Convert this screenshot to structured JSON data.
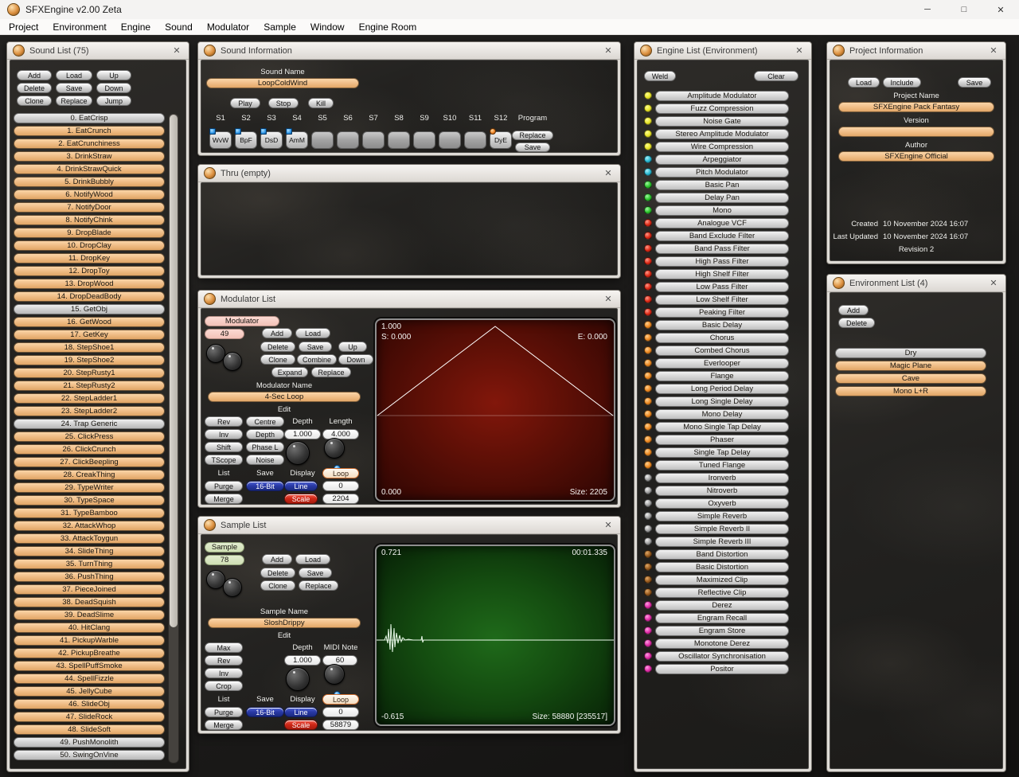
{
  "window": {
    "title": "SFXEngine v2.00 Zeta"
  },
  "icons": {
    "minimize": "─",
    "maximize": "□",
    "close": "✕"
  },
  "menu": {
    "items": [
      "Project",
      "Environment",
      "Engine",
      "Sound",
      "Modulator",
      "Sample",
      "Window",
      "Engine Room"
    ]
  },
  "sound_list": {
    "title": "Sound List (75)",
    "buttons": [
      "Add",
      "Load",
      "Up",
      "Delete",
      "Save",
      "Down",
      "Clone",
      "Replace",
      "Jump"
    ],
    "items": [
      {
        "label": "0. EatCrisp",
        "variant": "gray"
      },
      {
        "label": "1. EatCrunch",
        "variant": "peach"
      },
      {
        "label": "2. EatCrunchiness",
        "variant": "peach"
      },
      {
        "label": "3. DrinkStraw",
        "variant": "peach"
      },
      {
        "label": "4. DrinkStrawQuick",
        "variant": "peach"
      },
      {
        "label": "5. DrinkBubbly",
        "variant": "peach"
      },
      {
        "label": "6. NotifyWood",
        "variant": "peach"
      },
      {
        "label": "7. NotifyDoor",
        "variant": "peach"
      },
      {
        "label": "8. NotifyChink",
        "variant": "peach"
      },
      {
        "label": "9. DropBlade",
        "variant": "peach"
      },
      {
        "label": "10. DropClay",
        "variant": "peach"
      },
      {
        "label": "11. DropKey",
        "variant": "peach"
      },
      {
        "label": "12. DropToy",
        "variant": "peach"
      },
      {
        "label": "13. DropWood",
        "variant": "peach"
      },
      {
        "label": "14. DropDeadBody",
        "variant": "peach"
      },
      {
        "label": "15. GetObj",
        "variant": "gray"
      },
      {
        "label": "16. GetWood",
        "variant": "peach"
      },
      {
        "label": "17. GetKey",
        "variant": "peach"
      },
      {
        "label": "18. StepShoe1",
        "variant": "peach"
      },
      {
        "label": "19. StepShoe2",
        "variant": "peach"
      },
      {
        "label": "20. StepRusty1",
        "variant": "peach"
      },
      {
        "label": "21. StepRusty2",
        "variant": "peach"
      },
      {
        "label": "22. StepLadder1",
        "variant": "peach"
      },
      {
        "label": "23. StepLadder2",
        "variant": "peach"
      },
      {
        "label": "24. Trap Generic",
        "variant": "gray"
      },
      {
        "label": "25. ClickPress",
        "variant": "peach"
      },
      {
        "label": "26. ClickCrunch",
        "variant": "peach"
      },
      {
        "label": "27. ClickBeepling",
        "variant": "peach"
      },
      {
        "label": "28. CreakThing",
        "variant": "peach"
      },
      {
        "label": "29. TypeWriter",
        "variant": "peach"
      },
      {
        "label": "30. TypeSpace",
        "variant": "peach"
      },
      {
        "label": "31. TypeBamboo",
        "variant": "peach"
      },
      {
        "label": "32. AttackWhop",
        "variant": "peach"
      },
      {
        "label": "33. AttackToygun",
        "variant": "peach"
      },
      {
        "label": "34. SlideThing",
        "variant": "peach"
      },
      {
        "label": "35. TurnThing",
        "variant": "peach"
      },
      {
        "label": "36. PushThing",
        "variant": "peach"
      },
      {
        "label": "37. PieceJoined",
        "variant": "peach"
      },
      {
        "label": "38. DeadSquish",
        "variant": "peach"
      },
      {
        "label": "39. DeadSlime",
        "variant": "peach"
      },
      {
        "label": "40. HitClang",
        "variant": "peach"
      },
      {
        "label": "41. PickupWarble",
        "variant": "peach"
      },
      {
        "label": "42. PickupBreathe",
        "variant": "peach"
      },
      {
        "label": "43. SpellPuffSmoke",
        "variant": "peach"
      },
      {
        "label": "44. SpellFizzle",
        "variant": "peach"
      },
      {
        "label": "45. JellyCube",
        "variant": "peach"
      },
      {
        "label": "46. SlideObj",
        "variant": "peach"
      },
      {
        "label": "47. SlideRock",
        "variant": "peach"
      },
      {
        "label": "48. SlideSoft",
        "variant": "peach"
      },
      {
        "label": "49. PushMonolith",
        "variant": "gray"
      },
      {
        "label": "50. SwingOnVine",
        "variant": "gray"
      }
    ]
  },
  "sound_info": {
    "title": "Sound Information",
    "name_label": "Sound Name",
    "name_value": "LoopColdWind",
    "transport": {
      "play": "Play",
      "stop": "Stop",
      "kill": "Kill"
    },
    "program_label": "Program",
    "program": {
      "replace": "Replace",
      "save": "Save"
    },
    "slots": [
      {
        "label": "S1",
        "value": "WvW",
        "led": "blue"
      },
      {
        "label": "S2",
        "value": "BpF",
        "led": "blue"
      },
      {
        "label": "S3",
        "value": "DsD",
        "led": "blue"
      },
      {
        "label": "S4",
        "value": "AmM",
        "led": "blue"
      },
      {
        "label": "S5",
        "value": "",
        "led": ""
      },
      {
        "label": "S6",
        "value": "",
        "led": ""
      },
      {
        "label": "S7",
        "value": "",
        "led": ""
      },
      {
        "label": "S8",
        "value": "",
        "led": ""
      },
      {
        "label": "S9",
        "value": "",
        "led": ""
      },
      {
        "label": "S10",
        "value": "",
        "led": ""
      },
      {
        "label": "S11",
        "value": "",
        "led": ""
      },
      {
        "label": "S12",
        "value": "DyE",
        "led": "orange"
      }
    ]
  },
  "thru": {
    "title": "Thru (empty)"
  },
  "modulator": {
    "title": "Modulator List",
    "index_label": "Modulator",
    "index_value": "49",
    "btn": {
      "add": "Add",
      "load": "Load",
      "delete": "Delete",
      "save": "Save",
      "up": "Up",
      "clone": "Clone",
      "combine": "Combine",
      "down": "Down",
      "expand": "Expand",
      "replace": "Replace"
    },
    "name_label": "Modulator Name",
    "name_value": "4-Sec Loop",
    "edit_label": "Edit",
    "edit_btn": {
      "rev": "Rev",
      "centre": "Centre",
      "inv": "Inv",
      "depth": "Depth",
      "shift": "Shift",
      "phase": "Phase L",
      "tscope": "TScope",
      "noise": "Noise"
    },
    "depth_label": "Depth",
    "length_label": "Length",
    "depth_value": "1.000",
    "length_value": "4.000",
    "bottom": {
      "list": "List",
      "save": "Save",
      "display": "Display",
      "loop": "Loop",
      "purge": "Purge",
      "bit": "16-Bit",
      "line": "Line",
      "zero": "0",
      "merge": "Merge",
      "scale": "Scale",
      "size": "2204"
    },
    "display": {
      "top_left": "1.000",
      "start": "S: 0.000",
      "end": "E: 0.000",
      "bottom_left": "0.000",
      "size": "Size: 2205"
    }
  },
  "sample": {
    "title": "Sample List",
    "index_label": "Sample",
    "index_value": "78",
    "btn": {
      "add": "Add",
      "load": "Load",
      "delete": "Delete",
      "save": "Save",
      "clone": "Clone",
      "replace": "Replace"
    },
    "name_label": "Sample Name",
    "name_value": "SloshDrippy",
    "edit_label": "Edit",
    "edit_btn": {
      "max": "Max",
      "rev": "Rev",
      "inv": "Inv",
      "crop": "Crop"
    },
    "depth_label": "Depth",
    "midi_label": "MIDI Note",
    "depth_value": "1.000",
    "midi_value": "60",
    "bottom": {
      "list": "List",
      "save": "Save",
      "display": "Display",
      "loop": "Loop",
      "purge": "Purge",
      "bit": "16-Bit",
      "line": "Line",
      "zero": "0",
      "merge": "Merge",
      "scale": "Scale",
      "size": "58879"
    },
    "display": {
      "top_left": "0.721",
      "top_right": "00:01.335",
      "bottom_left": "-0.615",
      "size": "Size: 58880 [235517]"
    }
  },
  "engine_list": {
    "title": "Engine List (Environment)",
    "weld": "Weld",
    "clear": "Clear",
    "items": [
      {
        "label": "Amplitude Modulator",
        "dot": "yellow"
      },
      {
        "label": "Fuzz Compression",
        "dot": "yellow"
      },
      {
        "label": "Noise Gate",
        "dot": "yellow"
      },
      {
        "label": "Stereo Amplitude Modulator",
        "dot": "yellow"
      },
      {
        "label": "Wire Compression",
        "dot": "yellow"
      },
      {
        "label": "Arpeggiator",
        "dot": "cyan"
      },
      {
        "label": "Pitch Modulator",
        "dot": "cyan"
      },
      {
        "label": "Basic Pan",
        "dot": "green"
      },
      {
        "label": "Delay Pan",
        "dot": "green"
      },
      {
        "label": "Mono",
        "dot": "green"
      },
      {
        "label": "Analogue VCF",
        "dot": "red"
      },
      {
        "label": "Band Exclude Filter",
        "dot": "red"
      },
      {
        "label": "Band Pass Filter",
        "dot": "red"
      },
      {
        "label": "High Pass Filter",
        "dot": "red"
      },
      {
        "label": "High Shelf Filter",
        "dot": "red"
      },
      {
        "label": "Low Pass Filter",
        "dot": "red"
      },
      {
        "label": "Low Shelf Filter",
        "dot": "red"
      },
      {
        "label": "Peaking Filter",
        "dot": "red"
      },
      {
        "label": "Basic Delay",
        "dot": "orange"
      },
      {
        "label": "Chorus",
        "dot": "orange"
      },
      {
        "label": "Combed Chorus",
        "dot": "orange"
      },
      {
        "label": "Everlooper",
        "dot": "orange"
      },
      {
        "label": "Flange",
        "dot": "orange"
      },
      {
        "label": "Long Period Delay",
        "dot": "orange"
      },
      {
        "label": "Long Single Delay",
        "dot": "orange"
      },
      {
        "label": "Mono Delay",
        "dot": "orange"
      },
      {
        "label": "Mono Single Tap Delay",
        "dot": "orange"
      },
      {
        "label": "Phaser",
        "dot": "orange"
      },
      {
        "label": "Single Tap Delay",
        "dot": "orange"
      },
      {
        "label": "Tuned Flange",
        "dot": "orange"
      },
      {
        "label": "Ironverb",
        "dot": "gray"
      },
      {
        "label": "Nitroverb",
        "dot": "gray"
      },
      {
        "label": "Oxyverb",
        "dot": "gray"
      },
      {
        "label": "Simple Reverb",
        "dot": "gray"
      },
      {
        "label": "Simple Reverb II",
        "dot": "gray"
      },
      {
        "label": "Simple Reverb III",
        "dot": "gray"
      },
      {
        "label": "Band Distortion",
        "dot": "brown"
      },
      {
        "label": "Basic Distortion",
        "dot": "brown"
      },
      {
        "label": "Maximized Clip",
        "dot": "brown"
      },
      {
        "label": "Reflective Clip",
        "dot": "brown"
      },
      {
        "label": "Derez",
        "dot": "magenta"
      },
      {
        "label": "Engram Recall",
        "dot": "magenta"
      },
      {
        "label": "Engram Store",
        "dot": "magenta"
      },
      {
        "label": "Monotone Derez",
        "dot": "magenta"
      },
      {
        "label": "Oscillator Synchronisation",
        "dot": "magenta"
      },
      {
        "label": "Positor",
        "dot": "magenta"
      }
    ]
  },
  "project_info": {
    "title": "Project Information",
    "btn": {
      "load": "Load",
      "include": "Include",
      "save": "Save"
    },
    "project_name_label": "Project Name",
    "project_name": "SFXEngine Pack Fantasy",
    "version_label": "Version",
    "version": "",
    "author_label": "Author",
    "author": "SFXEngine Official",
    "created_label": "Created",
    "created": "10 November 2024 16:07",
    "updated_label": "Last Updated",
    "updated": "10 November 2024 16:07",
    "revision": "Revision 2"
  },
  "environment_list": {
    "title": "Environment List (4)",
    "btn": {
      "add": "Add",
      "delete": "Delete"
    },
    "items": [
      {
        "label": "Dry",
        "variant": "gray"
      },
      {
        "label": "Magic Plane",
        "variant": "peach"
      },
      {
        "label": "Cave",
        "variant": "peach"
      },
      {
        "label": "Mono L+R",
        "variant": "peach"
      }
    ]
  },
  "colors": {
    "accent_orange": "#efbc85",
    "led_blue": "#2f97e8",
    "led_orange": "#f08020",
    "display_red": "#5c0f06",
    "display_green": "#144c10"
  }
}
